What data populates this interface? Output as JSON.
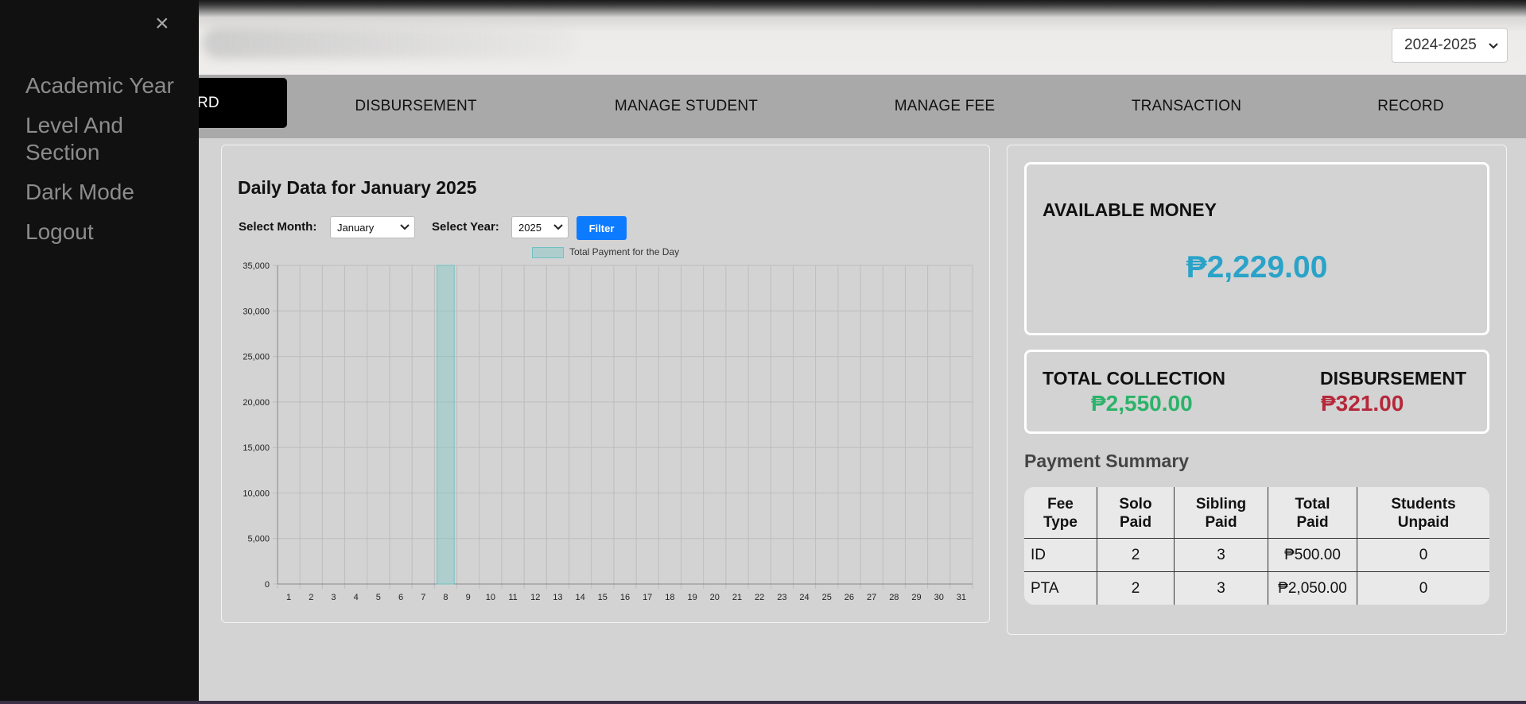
{
  "header": {
    "school_year": "2024-2025"
  },
  "nav": {
    "items": [
      {
        "label": "RD",
        "active": true
      },
      {
        "label": "DISBURSEMENT",
        "active": false
      },
      {
        "label": "MANAGE STUDENT",
        "active": false
      },
      {
        "label": "MANAGE FEE",
        "active": false
      },
      {
        "label": "TRANSACTION",
        "active": false
      },
      {
        "label": "RECORD",
        "active": false
      }
    ]
  },
  "sidebar": {
    "close_label": "×",
    "items": [
      {
        "label": "Academic Year"
      },
      {
        "label": "Level And Section"
      },
      {
        "label": "Dark Mode"
      },
      {
        "label": "Logout"
      }
    ]
  },
  "chart_panel": {
    "title": "Daily Data for January 2025",
    "month_label": "Select Month:",
    "month_value": "January",
    "year_label": "Select Year:",
    "year_value": "2025",
    "filter_label": "Filter"
  },
  "chart_data": {
    "type": "bar",
    "title": "Daily Data for January 2025",
    "legend": "Total Payment for the Day",
    "legend_position": "top",
    "grid": true,
    "categories": [
      "1",
      "2",
      "3",
      "4",
      "5",
      "6",
      "7",
      "8",
      "9",
      "10",
      "11",
      "12",
      "13",
      "14",
      "15",
      "16",
      "17",
      "18",
      "19",
      "20",
      "21",
      "22",
      "23",
      "24",
      "25",
      "26",
      "27",
      "28",
      "29",
      "30",
      "31"
    ],
    "values": [
      0,
      0,
      0,
      0,
      0,
      0,
      0,
      35000,
      0,
      0,
      0,
      0,
      0,
      0,
      0,
      0,
      0,
      0,
      0,
      0,
      0,
      0,
      0,
      0,
      0,
      0,
      0,
      0,
      0,
      0,
      0
    ],
    "ylim": [
      0,
      35000
    ],
    "yticks": [
      "0",
      "5,000",
      "10,000",
      "15,000",
      "20,000",
      "25,000",
      "30,000",
      "35,000"
    ],
    "bar_color": "#6fc2c2"
  },
  "summary": {
    "available_label": "AVAILABLE MONEY",
    "available_value": "₱2,229.00",
    "collection_label": "TOTAL COLLECTION",
    "collection_value": "₱2,550.00",
    "disbursement_label": "DISBURSEMENT",
    "disbursement_value": "₱321.00",
    "colors": {
      "available": "#2aa3c9",
      "collection": "#2bb36a",
      "disbursement": "#b5283a"
    }
  },
  "payment_summary": {
    "title": "Payment Summary",
    "columns": [
      "Fee Type",
      "Solo Paid",
      "Sibling Paid",
      "Total Paid",
      "Students Unpaid"
    ],
    "rows": [
      [
        "ID",
        "2",
        "3",
        "₱500.00",
        "0"
      ],
      [
        "PTA",
        "2",
        "3",
        "₱2,050.00",
        "0"
      ]
    ]
  }
}
